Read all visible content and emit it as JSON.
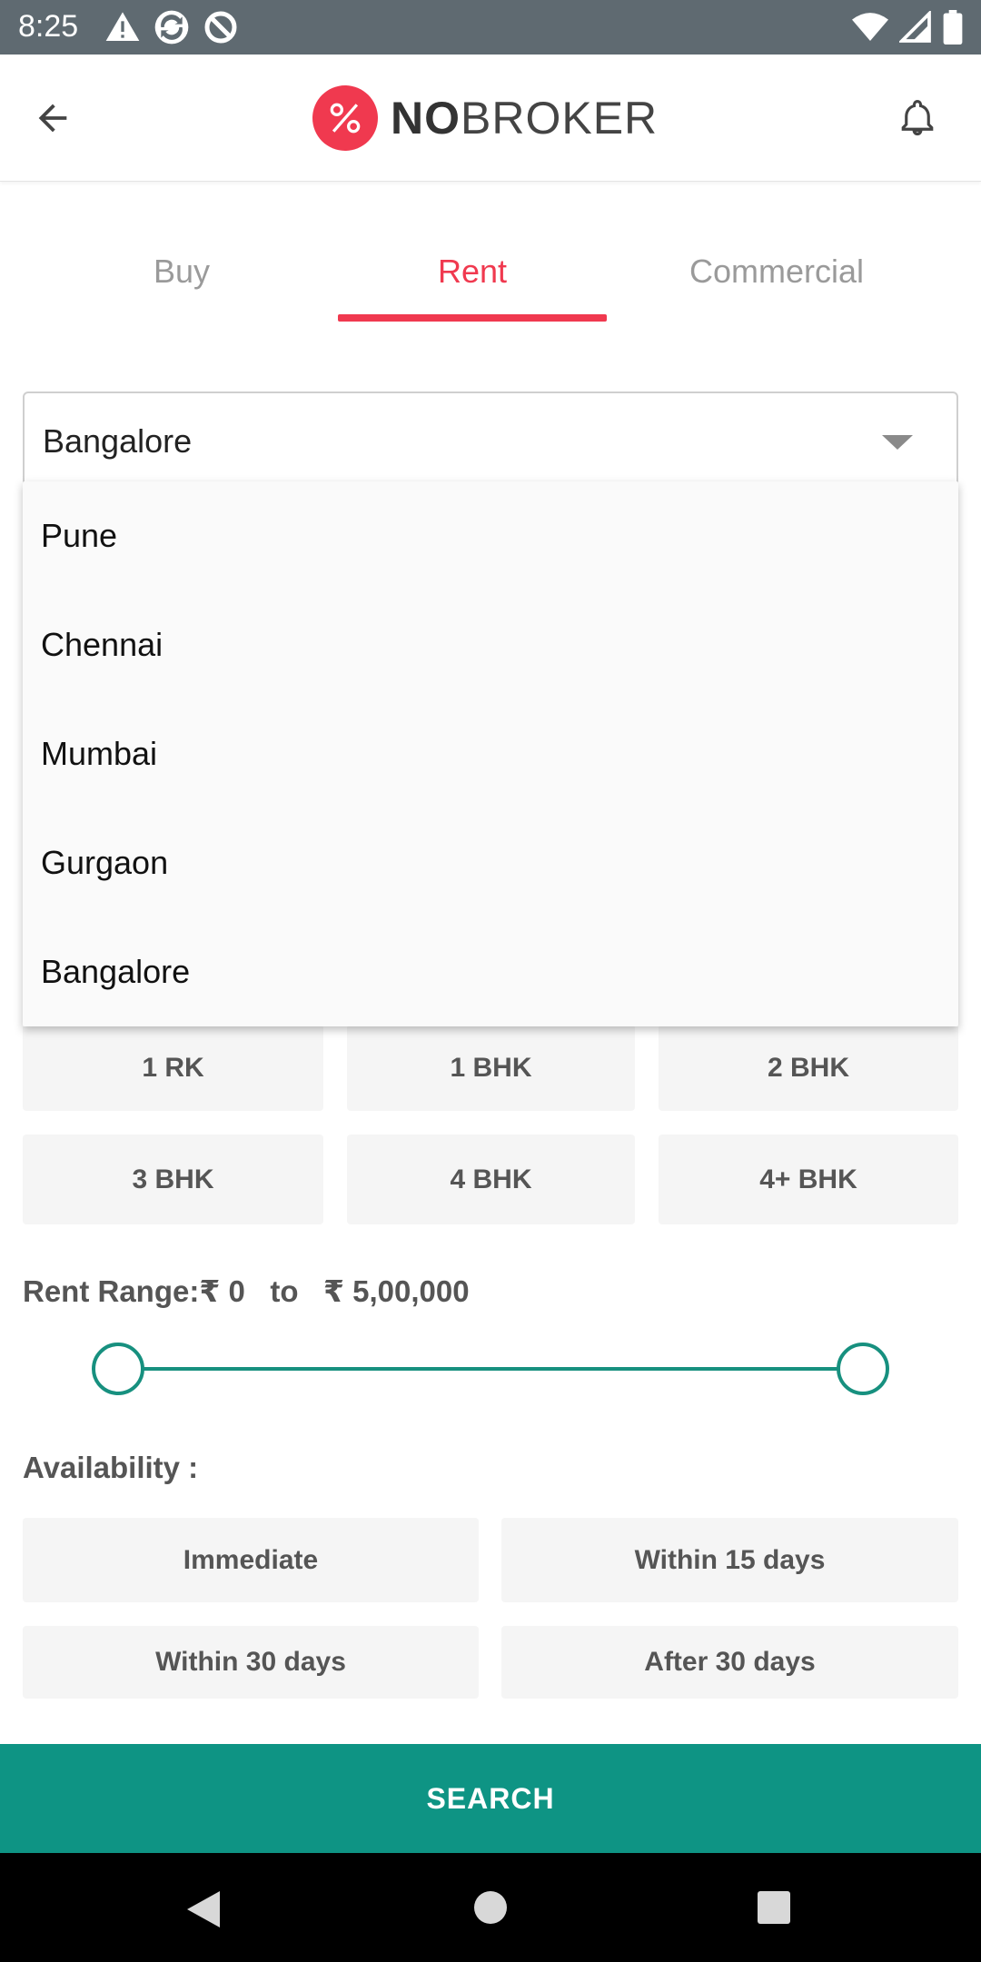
{
  "status_bar": {
    "time": "8:25",
    "icons": [
      "warning-icon",
      "sync-icon",
      "data-saver-icon",
      "wifi-icon",
      "signal-icon",
      "battery-icon"
    ]
  },
  "app_bar": {
    "logo_bold": "NO",
    "logo_light": "BROKER",
    "icons": [
      "back-arrow-icon",
      "bell-icon"
    ]
  },
  "tabs": [
    {
      "label": "Buy",
      "active": false
    },
    {
      "label": "Rent",
      "active": true
    },
    {
      "label": "Commercial",
      "active": false
    }
  ],
  "city_select": {
    "value": "Bangalore",
    "options": [
      "Pune",
      "Chennai",
      "Mumbai",
      "Gurgaon",
      "Bangalore"
    ]
  },
  "bhk": [
    "1 RK",
    "1 BHK",
    "2 BHK",
    "3 BHK",
    "4 BHK",
    "4+ BHK"
  ],
  "rent_range": {
    "text": "Rent Range:₹ 0   to   ₹ 5,00,000",
    "min_value": 0,
    "max_value": 500000
  },
  "availability": {
    "label": "Availability :",
    "options": [
      "Immediate",
      "Within 15 days",
      "Within 30 days",
      "After 30 days"
    ]
  },
  "search_button": "SEARCH",
  "colors": {
    "brand_red": "#f0394f",
    "accent_teal": "#0e9484",
    "status_bar": "#5f6a71"
  }
}
